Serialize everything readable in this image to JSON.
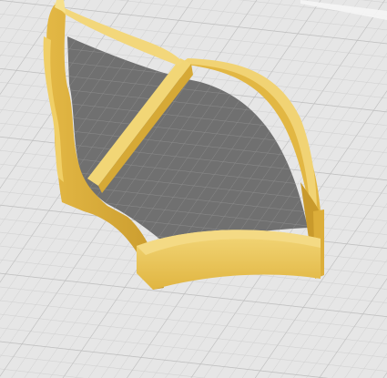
{
  "viewport": {
    "kind": "3d-slicer-build-plate-preview",
    "background_color": "#e6e6e6",
    "grid_minor_color": "#d0d0d0",
    "grid_major_color": "#bcbcbc"
  },
  "model": {
    "shape": "leaf-shaped-cookie-cutter",
    "has_center_divider": true,
    "colors": {
      "wall_top": "#f0d070",
      "wall_face_light": "#e8c050",
      "wall_face_dark": "#d8a830",
      "wall_shadow": "#c09028",
      "interior_floor": "#707070",
      "interior_grid": "#8a8a8a"
    }
  }
}
